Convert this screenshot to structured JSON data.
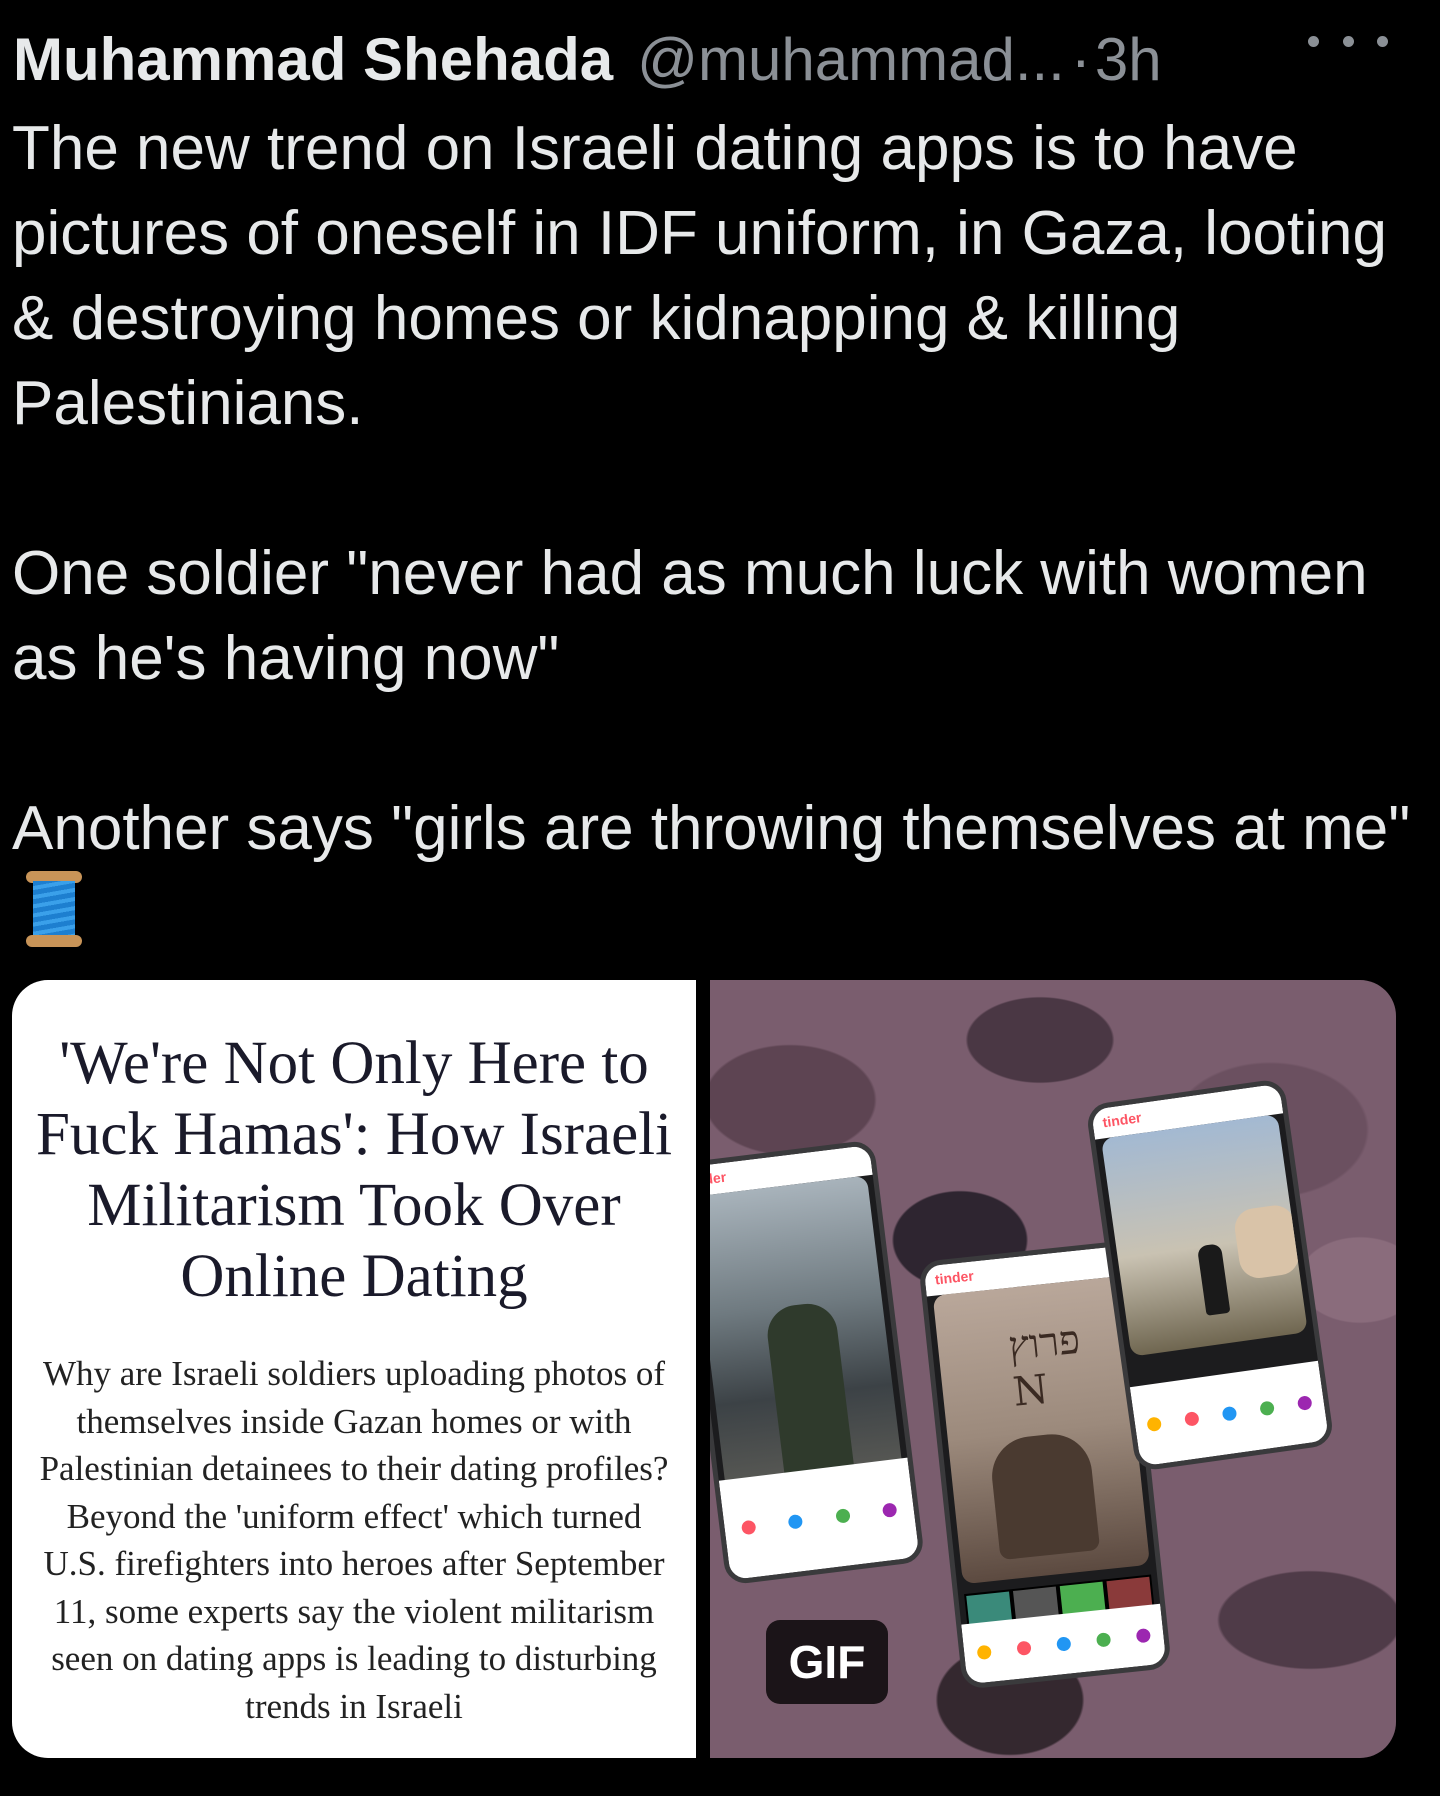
{
  "tweet": {
    "author_name": "Muhammad Shehada",
    "author_handle": "@muhammad...",
    "separator": "·",
    "time": "3h",
    "paragraphs": [
      "The new trend on Israeli dating apps is to have pictures of oneself in IDF uniform, in Gaza, looting & destroying homes or kidnapping & killing Palestinians.",
      "One soldier \"never had as much luck with women as he's having now\"",
      "Another says \"girls are throwing themselves at me\""
    ]
  },
  "article_card": {
    "title": "'We're Not Only Here to Fuck Hamas': How Israeli Militarism Took Over Online Dating",
    "description": "Why are Israeli soldiers uploading photos of themselves inside Gazan homes or with Palestinian detainees to their dating profiles? Beyond the 'uniform effect' which turned U.S. firefighters into heroes after September 11, some experts say the violent militarism seen on dating apps is leading to disturbing trends in Israeli"
  },
  "gif_media": {
    "badge": "GIF",
    "phone_app_label": "tinder",
    "phone1_app_label": "inder",
    "wall_text": "פרוץ N"
  },
  "colors": {
    "background": "#000000",
    "text_primary": "#e7e9ea",
    "text_secondary": "#8b9096",
    "tinder_red": "#fd5564"
  },
  "icons": [
    "more-options-icon",
    "spool-of-thread-icon"
  ]
}
